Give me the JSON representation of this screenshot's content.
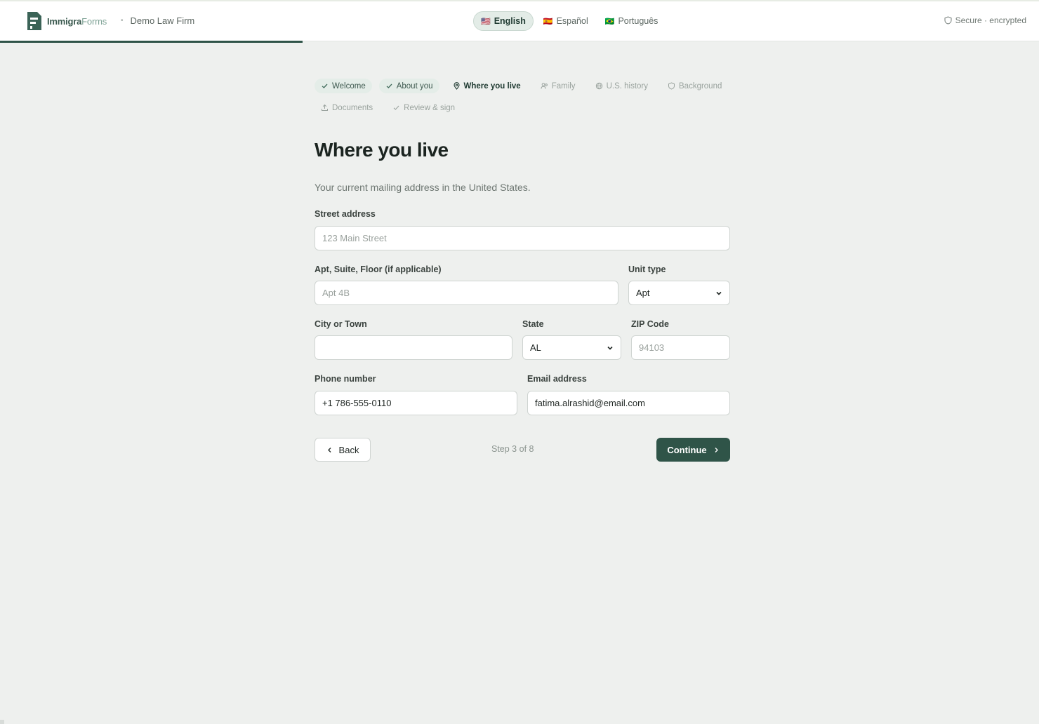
{
  "header": {
    "brand_main": "Immigra",
    "brand_accent": "Forms",
    "firm_name": "Demo Law Firm",
    "secure_text": "Secure · encrypted",
    "languages": [
      {
        "flag": "🇺🇸",
        "label": "English",
        "active": true
      },
      {
        "flag": "🇪🇸",
        "label": "Español",
        "active": false
      },
      {
        "flag": "🇧🇷",
        "label": "Português",
        "active": false
      }
    ],
    "progress_fraction": 0.375
  },
  "steps": [
    {
      "label": "Welcome",
      "status": "done",
      "icon": "check-icon"
    },
    {
      "label": "About you",
      "status": "done",
      "icon": "check-icon"
    },
    {
      "label": "Where you live",
      "status": "current",
      "icon": "map-pin-icon"
    },
    {
      "label": "Family",
      "status": "pending",
      "icon": "users-icon"
    },
    {
      "label": "U.S. history",
      "status": "pending",
      "icon": "globe-icon"
    },
    {
      "label": "Background",
      "status": "pending",
      "icon": "shield-icon"
    },
    {
      "label": "Documents",
      "status": "pending",
      "icon": "upload-icon"
    },
    {
      "label": "Review & sign",
      "status": "pending",
      "icon": "check-icon"
    }
  ],
  "page": {
    "title": "Where you live",
    "subtitle": "Your current mailing address in the United States."
  },
  "form": {
    "street": {
      "label": "Street address",
      "value": "",
      "placeholder": "123 Main Street"
    },
    "apt": {
      "label": "Apt, Suite, Floor (if applicable)",
      "value": "",
      "placeholder": "Apt 4B"
    },
    "unit_type": {
      "label": "Unit type",
      "value": "Apt"
    },
    "city": {
      "label": "City or Town",
      "value": "",
      "placeholder": ""
    },
    "state": {
      "label": "State",
      "value": "AL"
    },
    "zip": {
      "label": "ZIP Code",
      "value": "",
      "placeholder": "94103"
    },
    "phone": {
      "label": "Phone number",
      "value": "+1 786-555-0110",
      "placeholder": ""
    },
    "email": {
      "label": "Email address",
      "value": "fatima.alrashid@email.com",
      "placeholder": ""
    }
  },
  "nav": {
    "back_label": "Back",
    "step_text": "Step 3 of 8",
    "continue_label": "Continue"
  },
  "colors": {
    "accent": "#2f5448",
    "background": "#eef0ee",
    "done_step_bg": "#e4ede8"
  }
}
